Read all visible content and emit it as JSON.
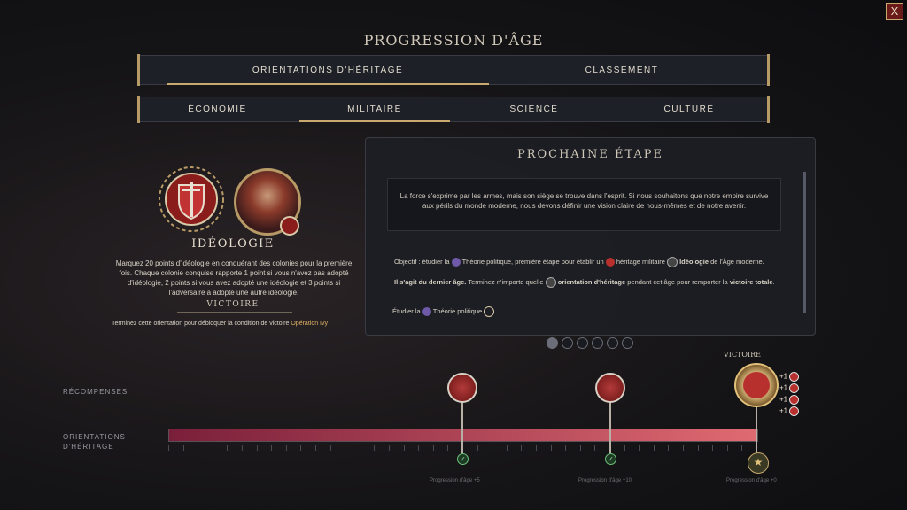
{
  "title": "PROGRESSION D'ÂGE",
  "close_label": "X",
  "main_tabs": [
    "ORIENTATIONS D'HÉRITAGE",
    "CLASSEMENT"
  ],
  "sub_tabs": [
    "ÉCONOMIE",
    "MILITAIRE",
    "SCIENCE",
    "CULTURE"
  ],
  "ideology": {
    "title": "IDÉOLOGIE",
    "description": "Marquez 20 points d'idéologie en conquérant des colonies pour la première fois. Chaque colonie conquise rapporte 1 point si vous n'avez pas adopté d'idéologie, 2 points si vous avez adopté une idéologie et 3 points si l'adversaire a adopté une autre idéologie.",
    "victory_heading": "VICTOIRE",
    "victory_text": "Terminez cette orientation pour débloquer la condition de victoire",
    "victory_link": "Opération Ivy"
  },
  "next_step": {
    "title": "PROCHAINE ÉTAPE",
    "quote": "La force s'exprime par les armes, mais son siège se trouve dans l'esprit. Si nous souhaitons que notre empire survive aux périls du monde moderne, nous devons définir une vision claire de nous-mêmes et de notre avenir.",
    "objective_a": "Objectif : étudier la",
    "objective_tech": "Théorie politique",
    "objective_b": ", première étape pour établir un",
    "objective_c": "héritage militaire",
    "objective_d": "Idéologie",
    "objective_e": "de l'Âge moderne.",
    "last_age_bold": "Il s'agit du dernier âge.",
    "last_age_a": "Terminez n'importe quelle",
    "last_age_b": "orientation d'héritage",
    "last_age_c": "pendant cet âge pour remporter la",
    "last_age_d": "victoire totale",
    "study_a": "Étudier la",
    "study_b": "Théorie politique"
  },
  "track": {
    "rewards_label": "RÉCOMPENSES",
    "orientations_label": "ORIENTATIONS D'HÉRITAGE",
    "victory_label": "VICTOIRE",
    "progress": 1.0,
    "plus_labels": [
      "+1",
      "+1",
      "+1",
      "+1"
    ],
    "captions": [
      "Progression d'âge +5",
      "Progression d'âge +10",
      "Progression d'âge +0"
    ]
  },
  "colors": {
    "accent": "#c9a96e",
    "bar_start": "#7a1f3a",
    "bar_end": "#e06a72",
    "emblem_red": "#b8302e"
  },
  "icons": [
    "close-icon",
    "shield-sword-icon",
    "leader-portrait-icon",
    "check-icon",
    "star-icon",
    "fist-reward-icon"
  ]
}
